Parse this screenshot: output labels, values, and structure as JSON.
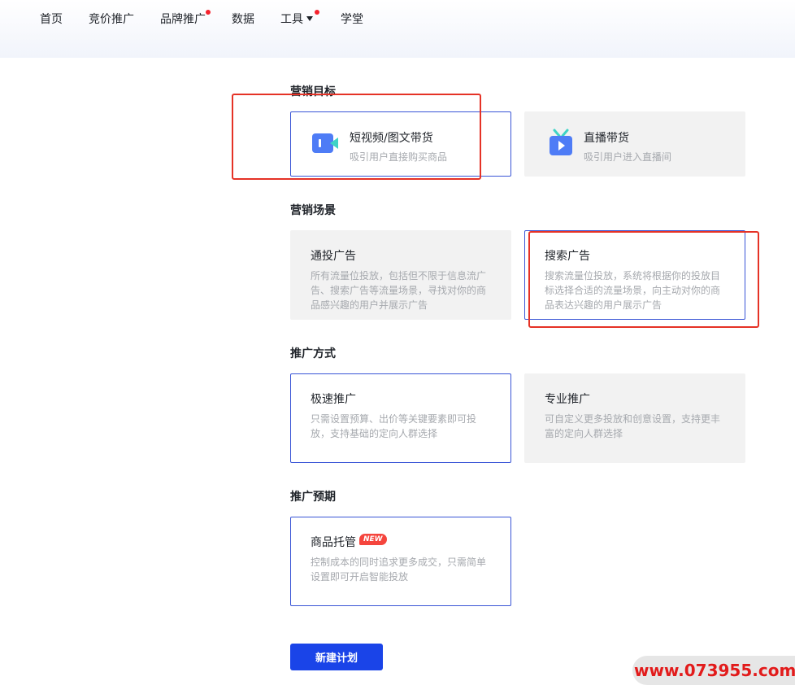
{
  "nav": {
    "items": [
      {
        "label": "首页"
      },
      {
        "label": "竞价推广"
      },
      {
        "label": "品牌推广"
      },
      {
        "label": "数据"
      },
      {
        "label": "工具"
      },
      {
        "label": "学堂"
      }
    ]
  },
  "sections": {
    "goal": {
      "title": "营销目标",
      "cards": [
        {
          "title": "短视频/图文带货",
          "desc": "吸引用户直接购买商品",
          "icon": "video-icon",
          "selected": true
        },
        {
          "title": "直播带货",
          "desc": "吸引用户进入直播间",
          "icon": "live-tv-icon",
          "selected": false
        }
      ]
    },
    "scene": {
      "title": "营销场景",
      "cards": [
        {
          "title": "通投广告",
          "desc": "所有流量位投放，包括但不限于信息流广告、搜索广告等流量场景，寻找对你的商品感兴趣的用户并展示广告",
          "selected": false
        },
        {
          "title": "搜索广告",
          "desc": "搜索流量位投放，系统将根据你的投放目标选择合适的流量场景，向主动对你的商品表达兴趣的用户展示广告",
          "selected": true
        }
      ]
    },
    "method": {
      "title": "推广方式",
      "cards": [
        {
          "title": "极速推广",
          "desc": "只需设置预算、出价等关键要素即可投放，支持基础的定向人群选择",
          "selected": true
        },
        {
          "title": "专业推广",
          "desc": "可自定义更多投放和创意设置，支持更丰富的定向人群选择",
          "selected": false
        }
      ]
    },
    "period": {
      "title": "推广预期",
      "cards": [
        {
          "title": "商品托管",
          "badge": "NEW",
          "desc": "控制成本的同时追求更多成交，只需简单设置即可开启智能投放",
          "selected": true
        }
      ]
    }
  },
  "actions": {
    "create_label": "新建计划"
  },
  "watermark": {
    "text": "www.073955.com"
  },
  "colors": {
    "accent": "#1a44e8",
    "selected_border": "#3955d6",
    "annotation_red": "#e53226",
    "dot_red": "#f5222d"
  }
}
